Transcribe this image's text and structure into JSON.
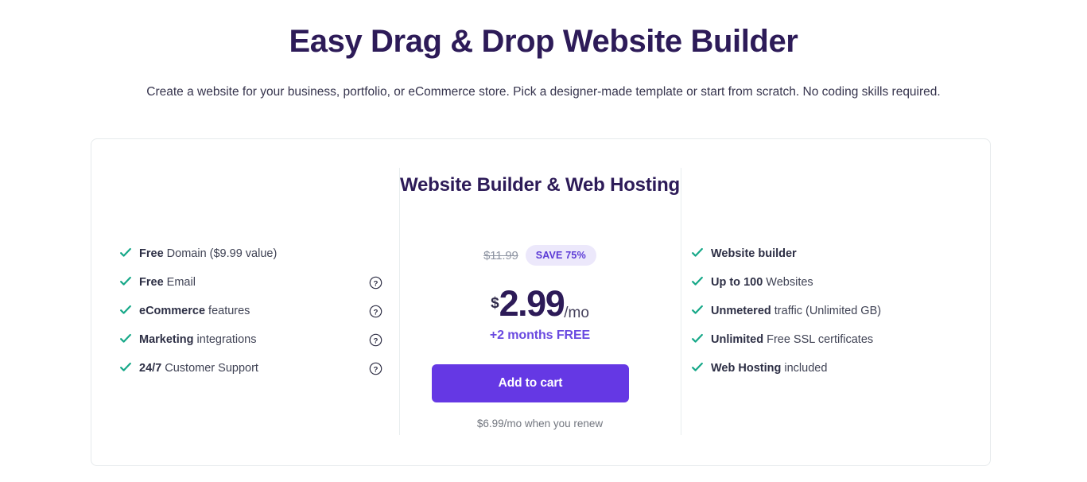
{
  "hero": {
    "title": "Easy Drag & Drop Website Builder",
    "subtitle": "Create a website for your business, portfolio, or eCommerce store. Pick a designer-made template or start from scratch. No coding skills required."
  },
  "colors": {
    "title_purple": "#2d1b58",
    "cta_purple": "#6538e4",
    "accent_violet": "#6a4ae0",
    "badge_bg": "#ece8fb",
    "badge_text": "#5b3ad6",
    "check_green": "#16a888",
    "card_border": "#e6eaec",
    "divider": "#e8edef"
  },
  "card": {
    "left_features": [
      {
        "bold": "Free",
        "rest": " Domain ($9.99 value)",
        "help": false,
        "icon": "check-icon"
      },
      {
        "bold": "Free",
        "rest": " Email",
        "help": true,
        "icon": "check-icon"
      },
      {
        "bold": "eCommerce",
        "rest": " features",
        "help": true,
        "icon": "check-icon"
      },
      {
        "bold": "Marketing",
        "rest": " integrations",
        "help": true,
        "icon": "check-icon"
      },
      {
        "bold": "24/7",
        "rest": " Customer Support",
        "help": true,
        "icon": "check-icon"
      }
    ],
    "right_features": [
      {
        "bold": "Website builder",
        "rest": "",
        "help": false,
        "icon": "check-icon"
      },
      {
        "bold": "Up to 100",
        "rest": " Websites",
        "help": false,
        "icon": "check-icon"
      },
      {
        "bold": "Unmetered",
        "rest": " traffic (Unlimited GB)",
        "help": false,
        "icon": "check-icon"
      },
      {
        "bold": "Unlimited",
        "rest": " Free SSL certificates",
        "help": false,
        "icon": "check-icon"
      },
      {
        "bold": "Web Hosting",
        "rest": " included",
        "help": false,
        "icon": "check-icon"
      }
    ],
    "plan": {
      "title": "Website Builder & Web Hosting",
      "old_price": "$11.99",
      "save_badge": "SAVE 75%",
      "currency": "$",
      "amount": "2.99",
      "period": "/mo",
      "bonus": "+2 months FREE",
      "cta_label": "Add to cart",
      "renew_note": "$6.99/mo when you renew"
    }
  }
}
